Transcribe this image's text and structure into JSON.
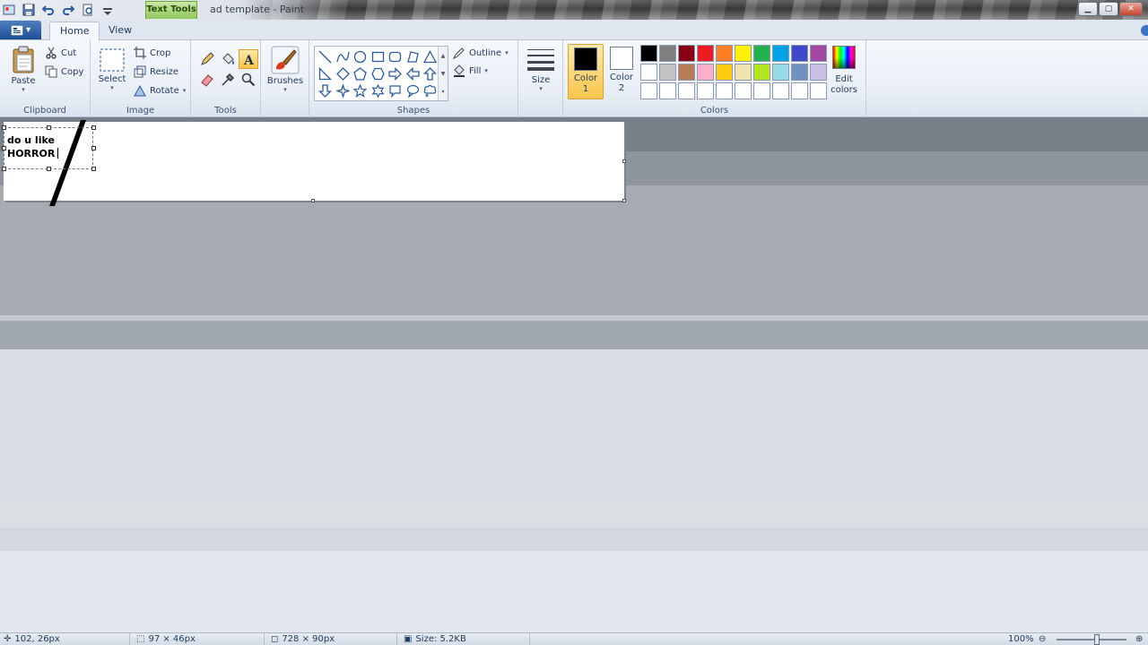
{
  "titlebar": {
    "context_tab": "Text Tools",
    "window_title": "ad template - Paint"
  },
  "tabs": [
    {
      "label": "Home"
    },
    {
      "label": "View"
    }
  ],
  "clipboard": {
    "paste": "Paste",
    "cut": "Cut",
    "copy": "Copy",
    "group_label": "Clipboard"
  },
  "image": {
    "select": "Select",
    "crop": "Crop",
    "resize": "Resize",
    "rotate": "Rotate",
    "group_label": "Image"
  },
  "tools": {
    "group_label": "Tools",
    "selected": "text"
  },
  "brushes": {
    "label": "Brushes"
  },
  "shapes": {
    "outline": "Outline",
    "fill": "Fill",
    "group_label": "Shapes"
  },
  "size": {
    "label": "Size"
  },
  "colors": {
    "color1_label_a": "Color",
    "color1_label_b": "1",
    "color2_label_a": "Color",
    "color2_label_b": "2",
    "color1": "#000000",
    "color2": "#ffffff",
    "edit_a": "Edit",
    "edit_b": "colors",
    "group_label": "Colors",
    "palette": [
      "#000000",
      "#7f7f7f",
      "#880015",
      "#ed1c24",
      "#ff7f27",
      "#fff200",
      "#22b14c",
      "#00a2e8",
      "#3f48cc",
      "#a349a4",
      "#ffffff",
      "#c3c3c3",
      "#b97a57",
      "#ffaec9",
      "#ffc90e",
      "#efe4b0",
      "#b5e61d",
      "#99d9ea",
      "#7092be",
      "#c8bfe7",
      "#ffffff",
      "#ffffff",
      "#ffffff",
      "#ffffff",
      "#ffffff",
      "#ffffff",
      "#ffffff",
      "#ffffff",
      "#ffffff",
      "#ffffff"
    ]
  },
  "canvas": {
    "text_line1": "do u like",
    "text_line2": "HORROR"
  },
  "status": {
    "cursor_pos": "102, 26px",
    "selection_size": "97 × 46px",
    "image_size": "728 × 90px",
    "file_size": "Size: 5.2KB",
    "zoom": "100%"
  }
}
